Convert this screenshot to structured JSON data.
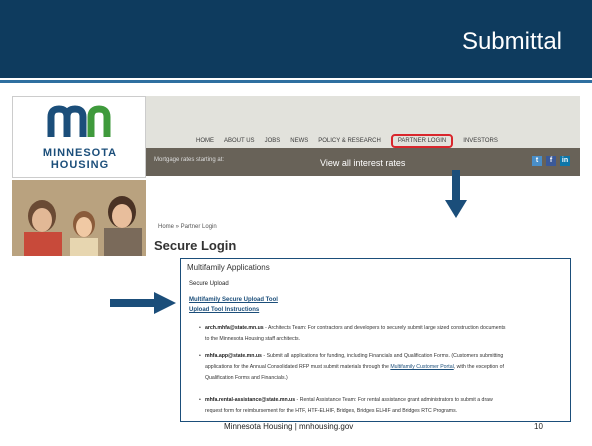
{
  "slide": {
    "title": "Submittal",
    "footer_center": "Minnesota Housing  |  mnhousing.gov",
    "page_number": "10"
  },
  "site": {
    "logo_line1": "MINNESOTA",
    "logo_line2": "HOUSING",
    "nav": [
      "HOME",
      "ABOUT US",
      "JOBS",
      "NEWS",
      "POLICY & RESEARCH",
      "PARTNER LOGIN",
      "INVESTORS"
    ],
    "rates_label": "Mortgage rates starting at:",
    "rates_link": "View all interest rates",
    "breadcrumb": "Home  »  Partner Login",
    "page_heading": "Secure Login"
  },
  "panel": {
    "heading": "Multifamily Applications",
    "subheading": "Secure Upload",
    "link1": "Multifamily Secure Upload Tool",
    "link2": "Upload Tool Instructions",
    "items": [
      {
        "email": "arch.mhfa@state.mn.us",
        "text": " - Architects Team: For contractors and developers to securely submit large sized construction documents",
        "text2": "to the Minnesota Housing staff architects."
      },
      {
        "email": "mhfa.app@state.mn.us",
        "text": " - Submit all applications for funding, including Financials and Qualification Forms. (Customers submitting",
        "text2": "applications for the Annual Consolidated RFP must submit materials through the ",
        "link": "Multifamily Customer Portal",
        "text3": ", with the exception of",
        "text4": "Qualification Forms and Financials.)"
      },
      {
        "email": "mhfa.rental-assistance@state.mn.us",
        "text": " - Rental Assistance Team: For rental assistance grant administrators to submit a draw",
        "text2": "request form for reimbursement for the HTF, HTF-ELHIF, Bridges, Bridges ELHIF and Bridges RTC Programs."
      }
    ]
  },
  "colors": {
    "title_bar": "#0e3b5e",
    "highlight": "#d9262c",
    "arrow": "#1b4e7a"
  }
}
